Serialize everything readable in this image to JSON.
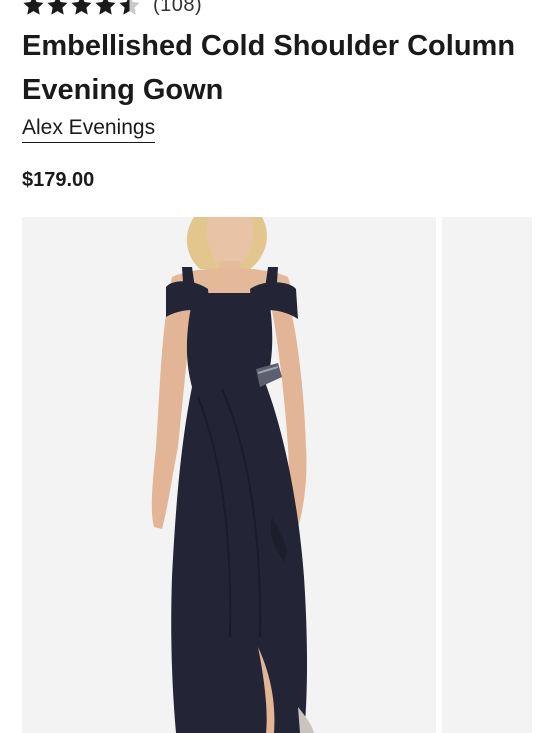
{
  "product": {
    "review_count": "(108)",
    "rating": 4.5,
    "rating_max": 5,
    "title": "Embellished Cold Shoulder Column Evening Gown",
    "brand": "Alex Evenings",
    "price": "$179.00"
  },
  "colors": {
    "star_filled": "#1a1a1a",
    "star_empty": "#c8c8c8",
    "gown": "#232536",
    "image_background": "#f3f3f3"
  },
  "gallery": {
    "images": [
      {
        "icon": "product-photo-evening-gown"
      },
      {
        "icon": "product-photo-next-partial"
      }
    ]
  }
}
